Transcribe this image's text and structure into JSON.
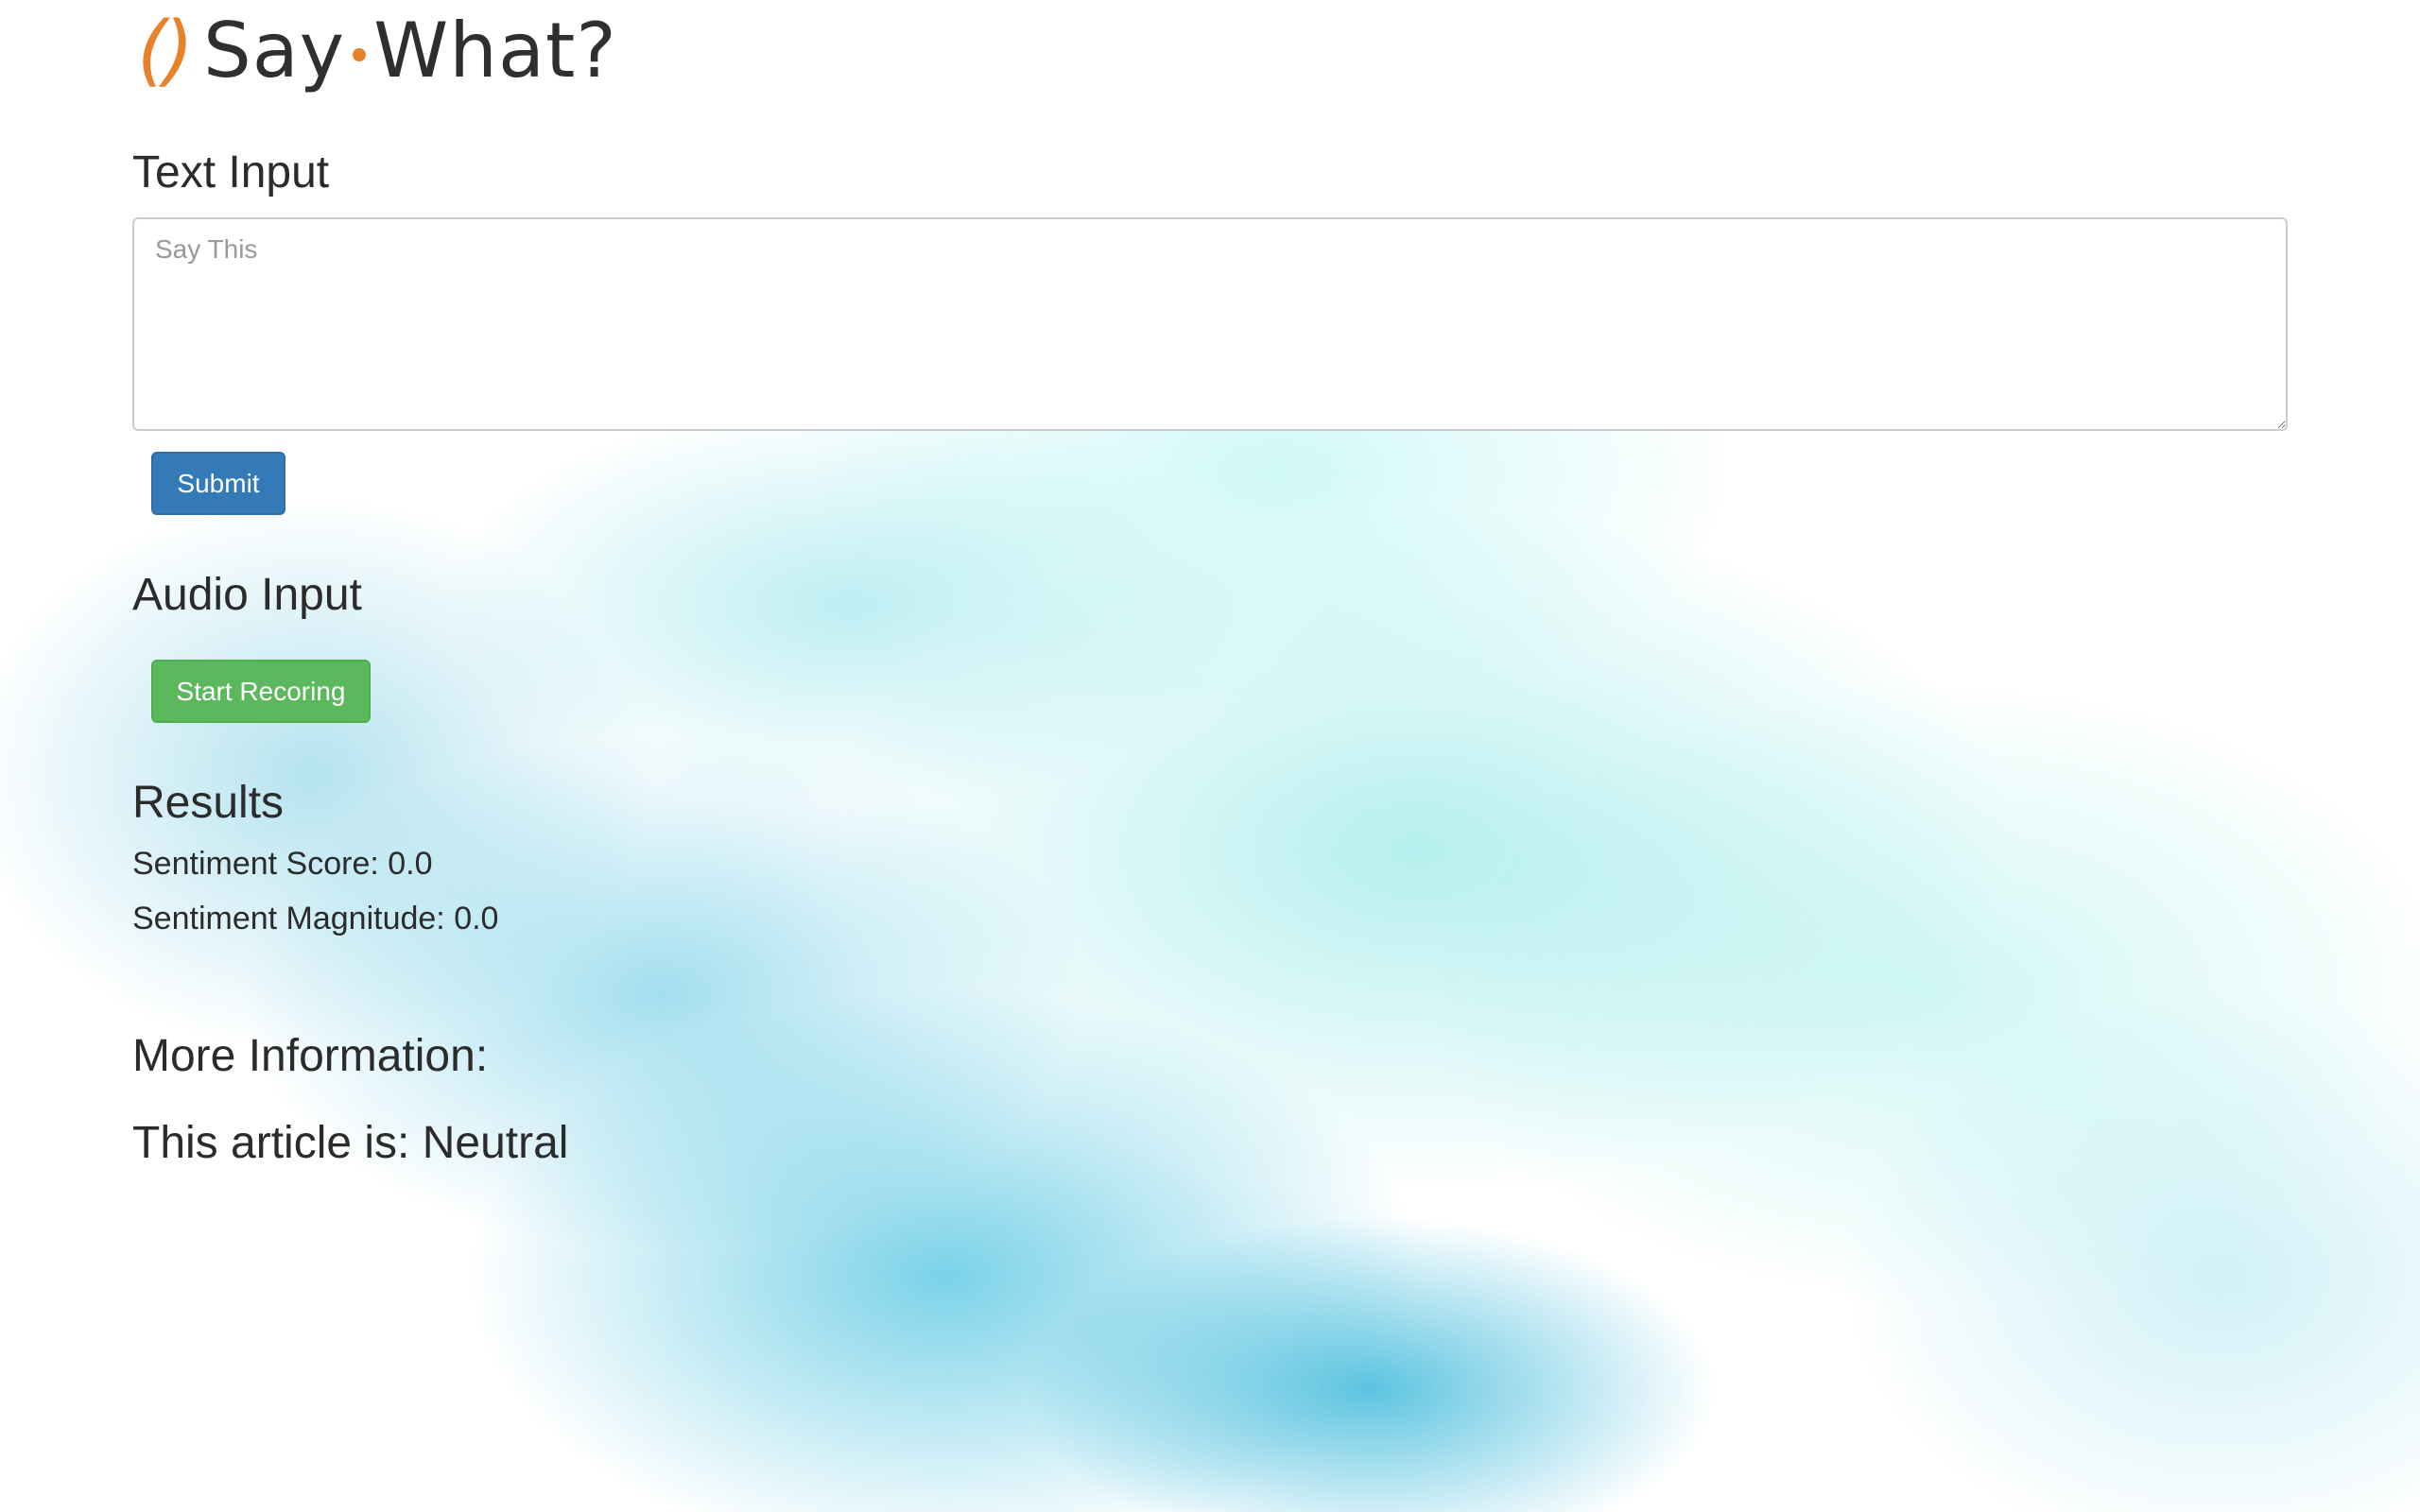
{
  "brand": {
    "paren": "()",
    "word1": "Say",
    "word2": "What?",
    "accent_color": "#e8822a"
  },
  "text_input": {
    "title": "Text Input",
    "placeholder": "Say This",
    "value": "",
    "submit_label": "Submit",
    "submit_color": "#337ab7"
  },
  "audio_input": {
    "title": "Audio Input",
    "record_label": "Start Recoring",
    "record_color": "#5cb85c"
  },
  "results": {
    "title": "Results",
    "score_text": "Sentiment Score: 0.0",
    "magnitude_text": "Sentiment Magnitude: 0.0"
  },
  "more_info": {
    "title": "More Information:",
    "article_text": "This article is: Neutral"
  }
}
